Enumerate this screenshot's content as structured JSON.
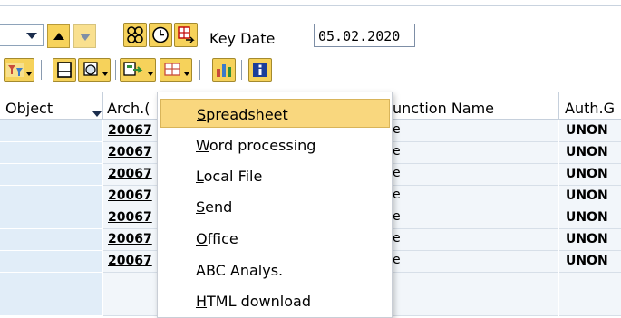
{
  "toolbar_top": {
    "key_date_label": "Key Date",
    "key_date_value": "05.02.2020"
  },
  "table": {
    "columns": [
      "Object",
      "Arch.(",
      "unction Name",
      "Auth.G"
    ],
    "rows": [
      {
        "arch": "20067",
        "func": "e",
        "auth": "UNON"
      },
      {
        "arch": "20067",
        "func": "e",
        "auth": "UNON"
      },
      {
        "arch": "20067",
        "func": "e",
        "auth": "UNON"
      },
      {
        "arch": "20067",
        "func": "e",
        "auth": "UNON"
      },
      {
        "arch": "20067",
        "func": "e",
        "auth": "UNON"
      },
      {
        "arch": "20067",
        "func": "e",
        "auth": "UNON"
      },
      {
        "arch": "20067",
        "func": "e",
        "auth": "UNON"
      }
    ]
  },
  "export_menu": {
    "items": [
      {
        "pre": "",
        "key": "S",
        "post": "preadsheet",
        "selected": true
      },
      {
        "pre": "",
        "key": "W",
        "post": "ord processing",
        "selected": false
      },
      {
        "pre": "",
        "key": "L",
        "post": "ocal File",
        "selected": false
      },
      {
        "pre": "",
        "key": "S",
        "post": "end",
        "selected": false
      },
      {
        "pre": "",
        "key": "O",
        "post": "ffice",
        "selected": false
      },
      {
        "pre": "ABC Analys.",
        "key": "",
        "post": "",
        "selected": false
      },
      {
        "pre": "",
        "key": "H",
        "post": "TML download",
        "selected": false
      }
    ]
  },
  "icons": {
    "toolbar_row1": [
      "dropdown-arrow-icon",
      "page-up-icon",
      "page-down-icon",
      "glasses-icon",
      "clock-icon",
      "print-icon"
    ],
    "toolbar_row2": [
      "filter-icon",
      "print-preview-icon",
      "export-icon",
      "layout-icon",
      "grid-icon",
      "chart-icon",
      "info-icon"
    ]
  },
  "colors": {
    "button_yellow": "#f6d25b",
    "menu_highlight": "#f9d77e",
    "row_blue": "#e1edf8",
    "cell_bg": "#f2f6fa"
  }
}
